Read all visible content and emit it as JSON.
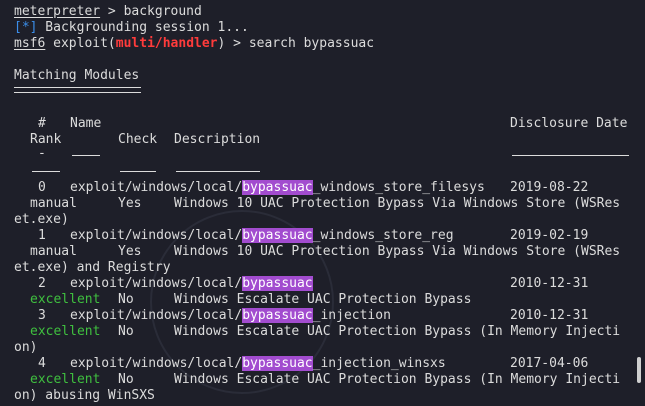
{
  "terminal": {
    "l1_prompt": "meterpreter",
    "l1_rest": " > background",
    "l2_tag": "[*]",
    "l2_text": " Backgrounding session 1...",
    "l3_prompt": "msf6",
    "l3_mid": " exploit(",
    "l3_module": "multi/handler",
    "l3_rest": ") > search bypassuac",
    "heading": "Matching Modules",
    "col_hash": "#",
    "col_name": "Name",
    "col_disclosure": "Disclosure Date",
    "col_rank": "Rank",
    "col_check": "Check",
    "col_description": "Description",
    "dash_hash": "-"
  },
  "rows": [
    {
      "num": "0",
      "prefix": "exploit/windows/local/",
      "match": "bypassuac",
      "suffix": "_windows_store_filesys",
      "date": "2019-08-22",
      "rank": "manual",
      "check": "Yes",
      "description": "Windows 10 UAC Protection Bypass Via Windows Store (WSRes",
      "wrap": "et.exe)"
    },
    {
      "num": "1",
      "prefix": "exploit/windows/local/",
      "match": "bypassuac",
      "suffix": "_windows_store_reg",
      "date": "2019-02-19",
      "rank": "manual",
      "check": "Yes",
      "description": "Windows 10 UAC Protection Bypass Via Windows Store (WSRes",
      "wrap": "et.exe) and Registry"
    },
    {
      "num": "2",
      "prefix": "exploit/windows/local/",
      "match": "bypassuac",
      "suffix": "",
      "date": "2010-12-31",
      "rank": "excellent",
      "check": "No",
      "description": "Windows Escalate UAC Protection Bypass",
      "wrap": ""
    },
    {
      "num": "3",
      "prefix": "exploit/windows/local/",
      "match": "bypassuac",
      "suffix": "_injection",
      "date": "2010-12-31",
      "rank": "excellent",
      "check": "No",
      "description": "Windows Escalate UAC Protection Bypass (In Memory Injecti",
      "wrap": "on)"
    },
    {
      "num": "4",
      "prefix": "exploit/windows/local/",
      "match": "bypassuac",
      "suffix": "_injection_winsxs",
      "date": "2017-04-06",
      "rank": "excellent",
      "check": "No",
      "description": "Windows Escalate UAC Protection Bypass (In Memory Injecti",
      "wrap": "on) abusing WinSXS"
    }
  ],
  "colors": {
    "background": "#1e1f29",
    "text": "#dcdcdc",
    "info_blue": "#3b8eea",
    "module_red": "#ff3b3b",
    "rank_green": "#3fbf3f",
    "highlight": "#a24ccf"
  }
}
